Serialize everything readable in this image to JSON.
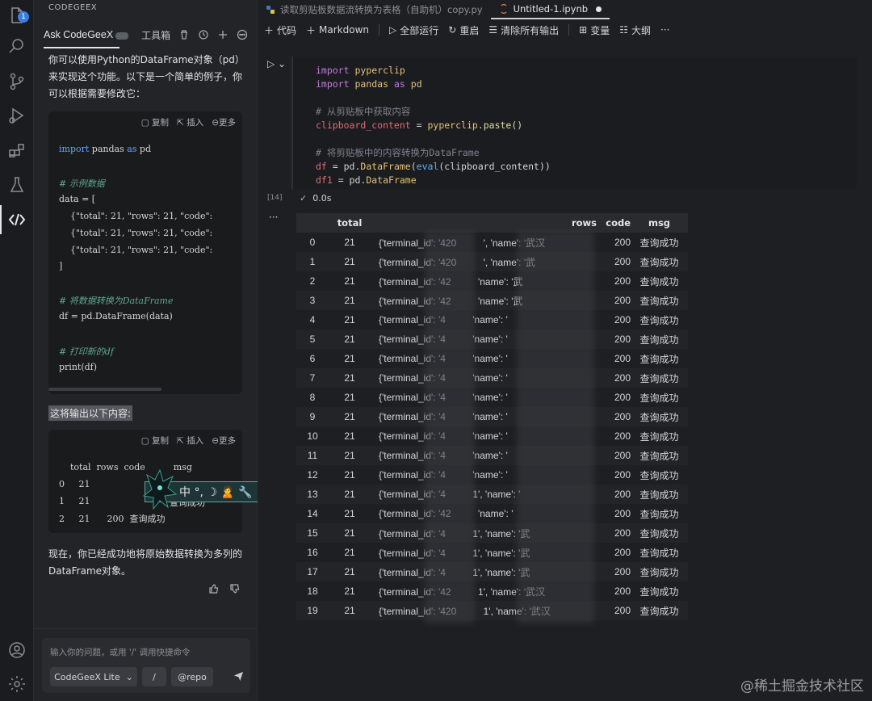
{
  "activity": {
    "badge": "1"
  },
  "panel": {
    "section_title": "CODEGEEX",
    "ask_title": "Ask CodeGeeX",
    "tools_label": "工具箱",
    "intro_text": "你可以使用Python的DataFrame对象（pd）来实现这个功能。以下是一个简单的例子，你可以根据需要修改它：",
    "code_actions": {
      "copy": "复制",
      "insert": "插入",
      "more": "更多"
    },
    "code_block": {
      "line1_kw": "import",
      "line1_rest": " pandas ",
      "line1_as": "as",
      "line1_alias": " pd",
      "comment1": "# 示例数据",
      "line_data": "data = [",
      "row_line": "    {\"total\": 21, \"rows\": 21, \"code\":",
      "close": "]",
      "comment2": "# 将数据转换为DataFrame",
      "line_df": "df = pd.DataFrame(data)",
      "comment3": "# 打印新的df",
      "line_print": "print(df)"
    },
    "highlight_text": "这将输出以下内容:",
    "output_block": {
      "header": "    total  rows  code          msg",
      "row0": "0     21",
      "row1": "1     21",
      "row2": "2     21      200  查询成功",
      "row1_msg": "查询成功"
    },
    "ime": {
      "label": "中 °, ☽ 🙎 🔧"
    },
    "conclusion_text": "现在，你已经成功地将原始数据转换为多列的DataFrame对象。",
    "input": {
      "placeholder": "输入你的问题，或用 '/' 调用快捷命令",
      "model": "CodeGeeX Lite",
      "slash": "/",
      "repo": "@repo"
    }
  },
  "editor": {
    "tabs": [
      {
        "label": "读取剪贴板数据流转换为表格（自助机）copy.py"
      },
      {
        "label": "Untitled-1.ipynb"
      }
    ],
    "toolbar": {
      "code": "代码",
      "markdown": "Markdown",
      "run_all": "全部运行",
      "restart": "重启",
      "clear_outputs": "清除所有输出",
      "variables": "变量",
      "outline": "大纲",
      "more": "···"
    },
    "cell": {
      "exec_count": "[14]",
      "exec_time": "0.0s",
      "lines": {
        "l1_kw": "import",
        "l1_mod": "pyperclip",
        "l2_kw": "import",
        "l2_mod": "pandas",
        "l2_as": "as",
        "l2_alias": "pd",
        "c1": "# 从剪贴板中获取内容",
        "l3_var": "clipboard_content",
        "l3_eq": " = ",
        "l3_mod": "pyperclip",
        "l3_fn": ".paste()",
        "c2": "# 将剪贴板中的内容转换为DataFrame",
        "l4_var": "df",
        "l4_rest": " = pd.",
        "l4_cls": "DataFrame",
        "l4_open": "(",
        "l4_fn": "eval",
        "l4_arg": "(clipboard_content))",
        "l5_var": "df1",
        "l5_rest": " = pd.",
        "l5_cls": "DataFrame"
      }
    },
    "dataframe": {
      "columns": [
        "total",
        "rows",
        "code",
        "msg"
      ],
      "rows": [
        {
          "idx": "0",
          "total": "21",
          "rows": "{'terminal_id': '420",
          "rows2": "', 'name': '武汉",
          "code": "200",
          "msg": "查询成功"
        },
        {
          "idx": "1",
          "total": "21",
          "rows": "{'terminal_id': '420",
          "rows2": "', 'name': '武",
          "code": "200",
          "msg": "查询成功"
        },
        {
          "idx": "2",
          "total": "21",
          "rows": "{'terminal_id': '42",
          "rows2": "'name': '武",
          "code": "200",
          "msg": "查询成功"
        },
        {
          "idx": "3",
          "total": "21",
          "rows": "{'terminal_id': '42",
          "rows2": "'name': '武",
          "code": "200",
          "msg": "查询成功"
        },
        {
          "idx": "4",
          "total": "21",
          "rows": "{'terminal_id': '4",
          "rows2": "'name': '",
          "code": "200",
          "msg": "查询成功"
        },
        {
          "idx": "5",
          "total": "21",
          "rows": "{'terminal_id': '4",
          "rows2": "'name': '",
          "code": "200",
          "msg": "查询成功"
        },
        {
          "idx": "6",
          "total": "21",
          "rows": "{'terminal_id': '4",
          "rows2": "'name': '",
          "code": "200",
          "msg": "查询成功"
        },
        {
          "idx": "7",
          "total": "21",
          "rows": "{'terminal_id': '4",
          "rows2": "'name': '",
          "code": "200",
          "msg": "查询成功"
        },
        {
          "idx": "8",
          "total": "21",
          "rows": "{'terminal_id': '4",
          "rows2": "'name': '",
          "code": "200",
          "msg": "查询成功"
        },
        {
          "idx": "9",
          "total": "21",
          "rows": "{'terminal_id': '4",
          "rows2": "'name': '",
          "code": "200",
          "msg": "查询成功"
        },
        {
          "idx": "10",
          "total": "21",
          "rows": "{'terminal_id': '4",
          "rows2": "'name': '",
          "code": "200",
          "msg": "查询成功"
        },
        {
          "idx": "11",
          "total": "21",
          "rows": "{'terminal_id': '4",
          "rows2": "'name': '",
          "code": "200",
          "msg": "查询成功"
        },
        {
          "idx": "12",
          "total": "21",
          "rows": "{'terminal_id': '4",
          "rows2": "'name': '",
          "code": "200",
          "msg": "查询成功"
        },
        {
          "idx": "13",
          "total": "21",
          "rows": "{'terminal_id': '4",
          "rows2": "1', 'name': '",
          "code": "200",
          "msg": "查询成功"
        },
        {
          "idx": "14",
          "total": "21",
          "rows": "{'terminal_id': '42",
          "rows2": "'name': '",
          "code": "200",
          "msg": "查询成功"
        },
        {
          "idx": "15",
          "total": "21",
          "rows": "{'terminal_id': '4",
          "rows2": "1', 'name': '武",
          "code": "200",
          "msg": "查询成功"
        },
        {
          "idx": "16",
          "total": "21",
          "rows": "{'terminal_id': '4",
          "rows2": "1', 'name': '武",
          "code": "200",
          "msg": "查询成功"
        },
        {
          "idx": "17",
          "total": "21",
          "rows": "{'terminal_id': '4",
          "rows2": "1', 'name': '武",
          "code": "200",
          "msg": "查询成功"
        },
        {
          "idx": "18",
          "total": "21",
          "rows": "{'terminal_id': '42",
          "rows2": "1', 'name': '武汉",
          "code": "200",
          "msg": "查询成功"
        },
        {
          "idx": "19",
          "total": "21",
          "rows": "{'terminal_id': '420",
          "rows2": "1', 'name': '武汉",
          "code": "200",
          "msg": "查询成功"
        }
      ]
    }
  },
  "watermark": "@稀土掘金技术社区"
}
